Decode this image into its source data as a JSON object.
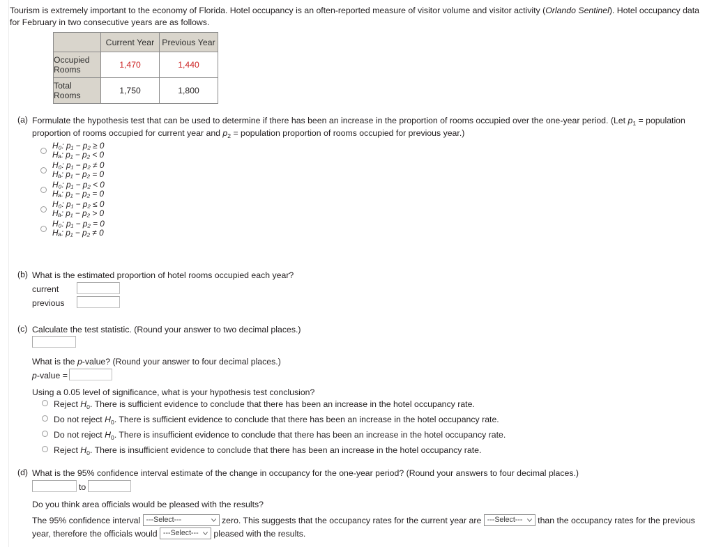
{
  "intro": {
    "text_before_italic": "Tourism is extremely important to the economy of Florida. Hotel occupancy is an often-reported measure of visitor volume and visitor activity (",
    "italic_source": "Orlando Sentinel",
    "text_after_italic": "). Hotel occupancy data for February in two consecutive years are as follows."
  },
  "table": {
    "corner_label": "",
    "columns": [
      "Current Year",
      "Previous Year"
    ],
    "rows": [
      {
        "label": "Occupied Rooms",
        "values": [
          "1,470",
          "1,440"
        ],
        "highlight": true
      },
      {
        "label": "Total Rooms",
        "values": [
          "1,750",
          "1,800"
        ],
        "highlight": false
      }
    ],
    "highlight_color": "#cc2222",
    "header_bg": "#d9d5cc"
  },
  "part_a": {
    "label": "(a)",
    "prompt_1": "Formulate the hypothesis test that can be used to determine if there has been an increase in the proportion of rooms occupied over the one-year period. (Let ",
    "prompt_p1": "p",
    "prompt_p1_sub": "1",
    "prompt_2": " = population proportion of rooms occupied for current year and ",
    "prompt_p2": "p",
    "prompt_p2_sub": "2",
    "prompt_3": " = population proportion of rooms occupied for previous year.)",
    "options": [
      {
        "null": "H₀: p₁ − p₂ ≥ 0",
        "alt": "Hₐ: p₁ − p₂ < 0"
      },
      {
        "null": "H₀: p₁ − p₂ ≠ 0",
        "alt": "Hₐ: p₁ − p₂ = 0"
      },
      {
        "null": "H₀: p₁ − p₂ < 0",
        "alt": "Hₐ: p₁ − p₂ = 0"
      },
      {
        "null": "H₀: p₁ − p₂ ≤ 0",
        "alt": "Hₐ: p₁ − p₂ > 0"
      },
      {
        "null": "H₀: p₁ − p₂ = 0",
        "alt": "Hₐ: p₁ − p₂ ≠ 0"
      }
    ]
  },
  "part_b": {
    "label": "(b)",
    "prompt": "What is the estimated proportion of hotel rooms occupied each year?",
    "current_label": "current",
    "current_value": "",
    "previous_label": "previous",
    "previous_value": ""
  },
  "part_c": {
    "label": "(c)",
    "prompt": "Calculate the test statistic. (Round your answer to two decimal places.)",
    "test_statistic_value": "",
    "pvalue_prompt_a": "What is the ",
    "pvalue_prompt_italic": "p",
    "pvalue_prompt_b": "-value? (Round your answer to four decimal places.)",
    "pvalue_label_italic": "p",
    "pvalue_label_rest": "-value =",
    "pvalue_value": "",
    "conclusion_prompt": "Using a 0.05 level of significance, what is your hypothesis test conclusion?",
    "conclusions": [
      {
        "a": "Reject ",
        "h": "H",
        "sub": "0",
        "b": ". There is sufficient evidence to conclude that there has been an increase in the hotel occupancy rate."
      },
      {
        "a": "Do not reject ",
        "h": "H",
        "sub": "0",
        "b": ". There is sufficient evidence to conclude that there has been an increase in the hotel occupancy rate."
      },
      {
        "a": "Do not reject ",
        "h": "H",
        "sub": "0",
        "b": ". There is insufficient evidence to conclude that there has been an increase in the hotel occupancy rate."
      },
      {
        "a": "Reject ",
        "h": "H",
        "sub": "0",
        "b": ". There is insufficient evidence to conclude that there has been an increase in the hotel occupancy rate."
      }
    ]
  },
  "part_d": {
    "label": "(d)",
    "prompt": "What is the 95% confidence interval estimate of the change in occupancy for the one-year period? (Round your answers to four decimal places.)",
    "ci_lower_value": "",
    "ci_to_label": "to",
    "ci_upper_value": "",
    "officials_prompt": "Do you think area officials would be pleased with the results?",
    "final_1": "The 95% confidence interval",
    "select_1": "---Select---",
    "final_2": "zero. This suggests that the occupancy rates for the current year are",
    "select_2": "---Select---",
    "final_3": "than the occupancy rates for the previous year, therefore the officials would",
    "select_3": "---Select---",
    "final_4": "pleased with the results."
  }
}
